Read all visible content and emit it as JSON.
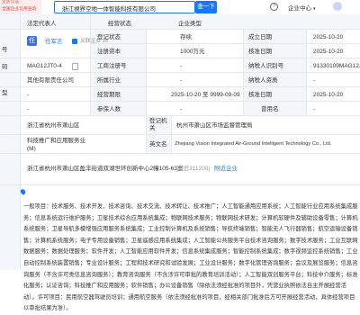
{
  "topbar": {
    "badge_line1": "企业认证",
    "badge_line2": "全国企业信用查询",
    "search_value": "浙江視界空地一体智能科技有限公司",
    "search_button": "查一下",
    "help_icon": "question-icon",
    "enterprise_center": "企业中心",
    "arrow": "▾"
  },
  "headers": {
    "legal_rep": "法定代表人",
    "biz_status": "经营状态",
    "enterprise_type": "企业类型"
  },
  "left_cut": {
    "t1": "号",
    "t2": "码",
    "t3": "型"
  },
  "legal_rep": {
    "avatar_char": "任",
    "name": "任军言",
    "related": "关联企业 28"
  },
  "rows": [
    {
      "l1": "登记状态",
      "v1": "存续",
      "l2": "成立日期",
      "v2": "2025-10-20"
    },
    {
      "l1": "注册资本",
      "v1": "1000万元",
      "l2": "核准日期",
      "v2": "2025-10-20"
    },
    {
      "l0": "MAG12JT0-4",
      "l1": "工商注册号",
      "v1": "-",
      "l2": "纳税人识别号",
      "v2": "91330109MAG12JT"
    },
    {
      "l0": "其他有限责任公司",
      "l1": "所属行业",
      "v1": "-",
      "l2": "纳税人资质",
      "v2": "-"
    },
    {
      "l0": "-",
      "l1": "经营期限",
      "v1": "2025-10-20 至 9999-09-09",
      "l2": "核准日期",
      "v2": "2025-10-20"
    },
    {
      "l0": "-",
      "l1": "参保人数",
      "v1": "-",
      "l2": "曾用名",
      "v2": "-"
    }
  ],
  "region": {
    "text": "浙江省杭州市萧山区",
    "label": "登记机关",
    "value": "杭州市萧山区市场监督管理局"
  },
  "industry": {
    "text1": "科技推广和应用服务业",
    "text2": "(M)",
    "label": "英文名",
    "value": "Zhejiang Vision Integrated Air-Ground Intelligent Technology Co., Ltd."
  },
  "address": {
    "text": "浙江省杭州市萧山区盈丰街道双湖世环创新中心2幢105-63室",
    "badge": "(附近311200)",
    "link": "附近企业"
  },
  "scope_text": "一般项目：技术服务、技术开发、技术咨询、技术交流、技术转让、技术推广；人工智能通用应用系统；人工智能行业应用系统集成服务；信息系统运行维护服务；卫星技术综合应用系统集成；物联网技术服务；物联网技术研发；计算机软硬件及辅助设备零售；计算机系统服务；卫星导航多模增强应用服务系统集成；工业控制计算机及系统销售；导航终端销售；智能无人飞行器销售；航空运输设备销售；计算机系统服务；电子专用设备销售；卫星遥感应用系统集成；人工智能公共服务平台技术咨询服务；数字技术服务；工业互联网数据服务；数据处理服务；软件开发；人工智能应用软件开发；信息系统集成服务；智能控制系统集成；数字视频监控系统销售；工业自动控制系统装置销售；专业设计服务；工程和技术研究和试验发展；工业设计服务；数字化管理咨询服务；会议及展览服务；信息咨询服务（不含许可类信息咨询服务）；教育咨询服务（不含涉许可审批的教育培训活动）；人工智能双创服务平台；科技中介服务；标准化服务；认证咨询；科技推广和应用服务；软件销售；办公设备销售（除依法须经批准的项目外，凭营业执照依法自主开展经营活动）。许可项目：民用航空器驾驶员培训；通用航空服务（依法须经批准的项目，经相关部门批准后方可开展经营活动，具体经营项目以审批结果为准）。"
}
